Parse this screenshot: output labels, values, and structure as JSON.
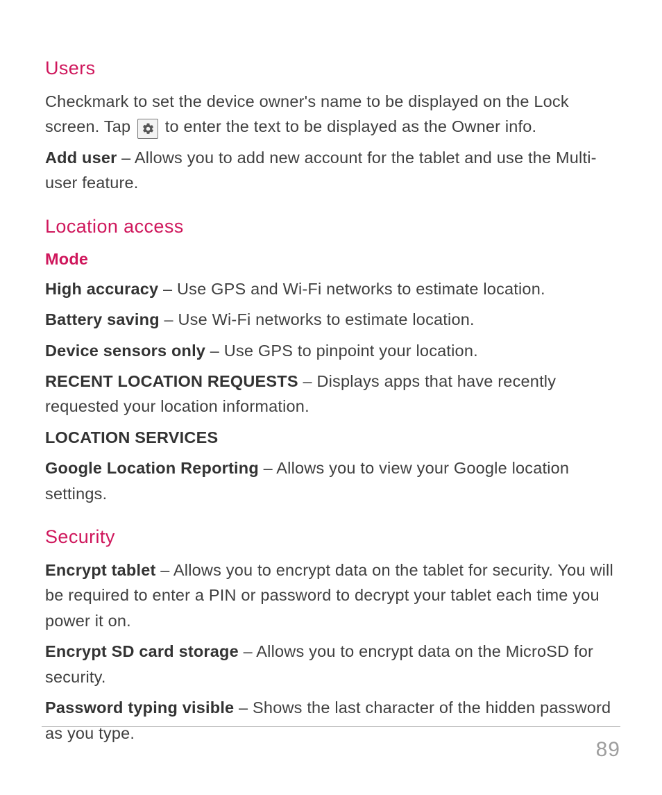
{
  "colors": {
    "accent": "#cf175c",
    "body": "#3f3f3f",
    "muted": "#9e9e9e"
  },
  "sections": {
    "users": {
      "heading": "Users",
      "intro_1": "Checkmark to set the device owner's name to be displayed on the Lock screen. Tap ",
      "intro_2": " to enter the text to be displayed as the Owner info.",
      "add_user_label": "Add user",
      "add_user_desc": " – Allows you to add new account for the tablet and use the Multi-user feature."
    },
    "location": {
      "heading": "Location access",
      "mode_heading": "Mode",
      "items": [
        {
          "label": "High accuracy",
          "desc": " – Use GPS and Wi-Fi networks to estimate location."
        },
        {
          "label": "Battery saving",
          "desc": " – Use Wi-Fi networks to estimate location."
        },
        {
          "label": "Device sensors only",
          "desc": " – Use GPS to pinpoint your location."
        }
      ],
      "recent_label": "RECENT LOCATION REQUESTS",
      "recent_desc": " – Displays apps that have recently requested your location information.",
      "services_heading": "LOCATION SERVICES",
      "reporting_label": "Google Location Reporting",
      "reporting_desc": " – Allows you to view your Google location settings."
    },
    "security": {
      "heading": "Security",
      "items": [
        {
          "label": "Encrypt tablet",
          "desc": " – Allows you to encrypt data on the tablet for security. You will be required to enter a PIN or password to decrypt your tablet each time you power it on."
        },
        {
          "label": "Encrypt SD card storage",
          "desc": " – Allows you to encrypt data on the MicroSD for security."
        },
        {
          "label": "Password typing visible",
          "desc": " – Shows the last character of the hidden password as you type."
        }
      ]
    }
  },
  "page_number": "89"
}
